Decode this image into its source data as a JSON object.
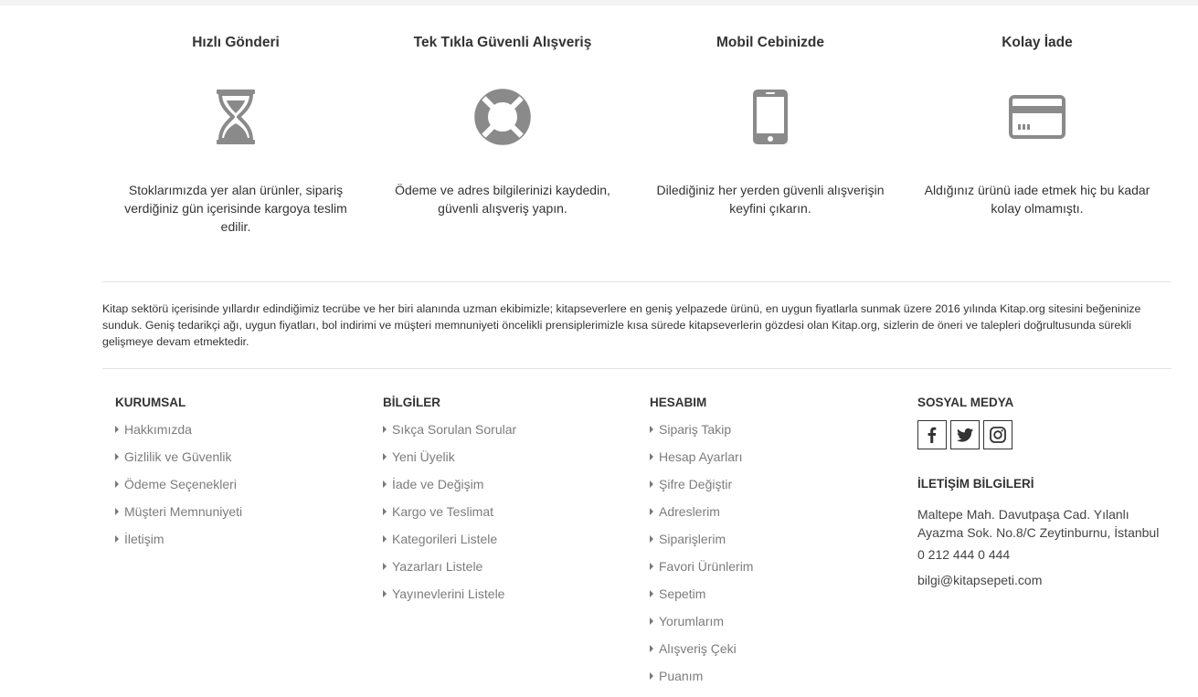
{
  "features": [
    {
      "title": "Hızlı Gönderi",
      "icon": "hourglass-icon",
      "text": "Stoklarımızda yer alan ürünler, sipariş verdiğiniz gün içerisinde kargoya teslim edilir."
    },
    {
      "title": "Tek Tıkla Güvenli Alışveriş",
      "icon": "lifebuoy-icon",
      "text": "Ödeme ve adres bilgilerinizi kaydedin, güvenli alışveriş yapın."
    },
    {
      "title": "Mobil Cebinizde",
      "icon": "mobile-phone-icon",
      "text": "Dilediğiniz her yerden güvenli alışverişin keyfini çıkarın."
    },
    {
      "title": "Kolay İade",
      "icon": "credit-card-icon",
      "text": "Aldığınız ürünü iade etmek hiç bu kadar kolay olmamıştı."
    }
  ],
  "about": "Kitap sektörü içerisinde yıllardır edindiğimiz tecrübe ve her biri alanında uzman ekibimizle; kitapseverlere en geniş yelpazede ürünü, en uygun fiyatlarla sunmak üzere 2016 yılında Kitap.org sitesini beğeninize sunduk. Geniş tedarikçi ağı, uygun fiyatları, bol indirimi ve müşteri memnuniyeti öncelikli prensiplerimizle kısa sürede kitapseverlerin gözdesi olan Kitap.org, sizlerin de öneri ve talepleri doğrultusunda sürekli gelişmeye devam etmektedir.",
  "kurumsal": {
    "title": "KURUMSAL",
    "items": [
      "Hakkımızda",
      "Gizlilik ve Güvenlik",
      "Ödeme Seçenekleri",
      "Müşteri Memnuniyeti",
      "İletişim"
    ]
  },
  "bilgiler": {
    "title": "BİLGİLER",
    "items": [
      "Sıkça Sorulan Sorular",
      "Yeni Üyelik",
      "İade ve Değişim",
      "Kargo ve Teslimat",
      "Kategorileri Listele",
      "Yazarları Listele",
      "Yayınevlerini Listele"
    ]
  },
  "hesabim": {
    "title": "HESABIM",
    "items": [
      "Sipariş Takip",
      "Hesap Ayarları",
      "Şifre Değiştir",
      "Adreslerim",
      "Siparişlerim",
      "Favori Ürünlerim",
      "Sepetim",
      "Yorumlarım",
      "Alışveriş Çeki",
      "Puanım"
    ]
  },
  "sosyal": {
    "title": "SOSYAL MEDYA",
    "icons": [
      "facebook-icon",
      "twitter-icon",
      "instagram-icon"
    ]
  },
  "iletisim": {
    "title": "İLETİŞİM BİLGİLERİ",
    "address_line1": "Maltepe Mah. Davutpaşa Cad. Yılanlı",
    "address_line2": "Ayazma Sok. No.8/C Zeytinburnu, İstanbul",
    "phone": "0 212 444 0 444",
    "email": "bilgi@kitapsepeti.com"
  },
  "colors": {
    "icon_gray": "#8a8a8a",
    "link_gray": "#7c7c7c",
    "text_dark": "#333333",
    "divider": "#e2e2e2"
  }
}
